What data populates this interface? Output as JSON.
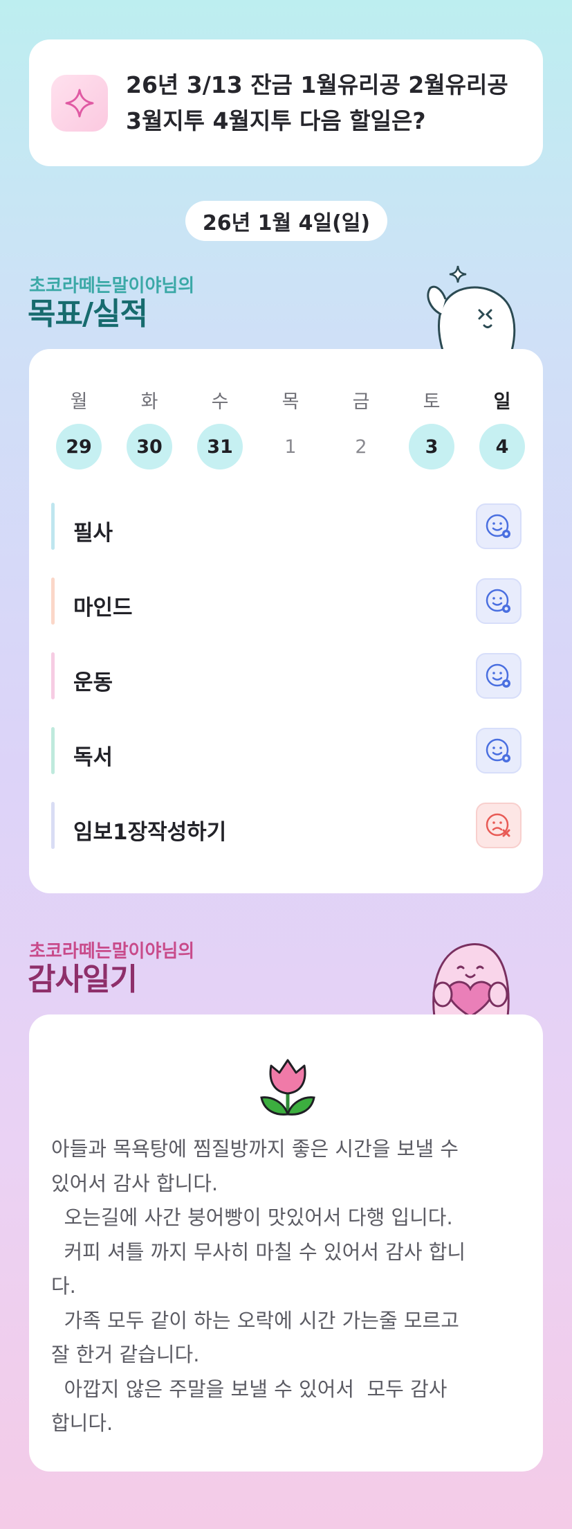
{
  "question": {
    "icon": "sparkle-icon",
    "text": "26년 3/13 잔금 1월유리공 2월유리공 3월지투 4월지투 다음 할일은?"
  },
  "date": "26년 1월 4일(일)",
  "goals_section": {
    "subtitle": "초코라떼는말이야님의",
    "title": "목표/실적"
  },
  "week": [
    {
      "day": "월",
      "num": "29",
      "done": true
    },
    {
      "day": "화",
      "num": "30",
      "done": true
    },
    {
      "day": "수",
      "num": "31",
      "done": true
    },
    {
      "day": "목",
      "num": "1",
      "done": false
    },
    {
      "day": "금",
      "num": "2",
      "done": false
    },
    {
      "day": "토",
      "num": "3",
      "done": true
    },
    {
      "day": "일",
      "num": "4",
      "done": true
    }
  ],
  "goals": [
    {
      "label": "필사",
      "color": "#bfe6ef",
      "status": "smile-icon"
    },
    {
      "label": "마인드",
      "color": "#fbd7c8",
      "status": "smile-icon"
    },
    {
      "label": "운동",
      "color": "#f6cce3",
      "status": "smile-icon"
    },
    {
      "label": "독서",
      "color": "#bfeadd",
      "status": "smile-icon"
    },
    {
      "label": "임보1장작성하기",
      "color": "#d9ddf4",
      "status": "sad-icon"
    }
  ],
  "gratitude_section": {
    "subtitle": "초코라떼는말이야님의",
    "title": "감사일기",
    "icon": "tulip-icon",
    "lines": [
      "아들과 목욕탕에 찜질방까지 좋은 시간을 보낼 수",
      "있어서 감사 합니다.",
      "  오는길에 사간 붕어빵이 맛있어서 다행 입니다.",
      "  커피 셔틀 까지 무사히 마칠 수 있어서 감사 합니",
      "다.",
      "  가족 모두 같이 하는 오락에 시간 가는줄 모르고",
      "잘 한거 같습니다.",
      "  아깝지 않은 주말을 보낼 수 있어서  모두 감사",
      "합니다."
    ]
  },
  "colors": {
    "accent_teal": "#176b6e",
    "accent_pink": "#8e2f6a",
    "day_done": "#c6f0f2",
    "status_ok": "#4a6fe0",
    "status_fail": "#e85a55"
  }
}
